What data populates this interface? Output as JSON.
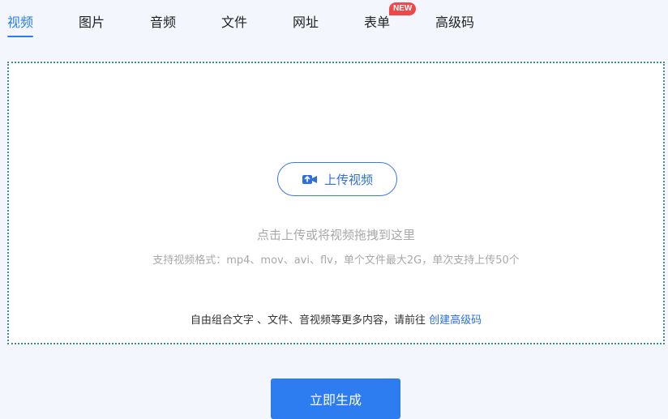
{
  "tabs": [
    {
      "label": "视频",
      "active": true
    },
    {
      "label": "图片"
    },
    {
      "label": "音频"
    },
    {
      "label": "文件"
    },
    {
      "label": "网址"
    },
    {
      "label": "表单",
      "badge": "NEW"
    },
    {
      "label": "高级码"
    }
  ],
  "upload": {
    "button_label": "上传视频",
    "icon": "video-upload-icon",
    "hint": "点击上传或将视频拖拽到这里",
    "formats": "支持视频格式：mp4、mov、avi、flv，单个文件最大2G，单次支持上传50个",
    "combo_text": "自由组合文字 、文件、音视频等更多内容，请前往",
    "combo_link": "创建高级码"
  },
  "generate_label": "立即生成",
  "colors": {
    "accent": "#2d7df0",
    "badge": "#f04848",
    "background": "#f3f7fd"
  }
}
